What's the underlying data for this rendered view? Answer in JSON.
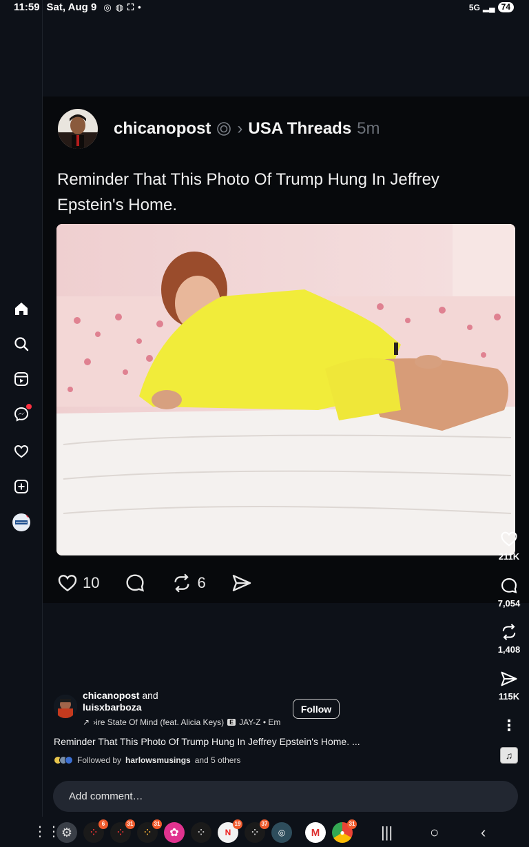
{
  "status_bar": {
    "time": "11:59",
    "date": "Sat, Aug 9",
    "network": "5G",
    "battery": "74"
  },
  "nav_rail": {
    "items": [
      {
        "icon": "home-icon"
      },
      {
        "icon": "search-icon"
      },
      {
        "icon": "reels-icon"
      },
      {
        "icon": "messenger-icon"
      },
      {
        "icon": "heart-icon"
      },
      {
        "icon": "create-icon"
      },
      {
        "icon": "profile-avatar"
      }
    ]
  },
  "post": {
    "username": "chicanopost",
    "community": "USA Threads",
    "time": "5m",
    "text": "Reminder That This Photo Of Trump Hung In Jeffrey Epstein's Home.",
    "likes": "10",
    "reposts": "6"
  },
  "right_actions": {
    "likes": "211K",
    "comments": "7,054",
    "reposts": "1,408",
    "shares": "115K"
  },
  "reel": {
    "user1": "chicanopost",
    "and": "and",
    "user2": "luisxbarboza",
    "follow_label": "Follow",
    "music": "›ire State Of Mind (feat. Alicia Keys)",
    "explicit": "E",
    "artist": "JAY-Z • Em",
    "caption": "Reminder That This Photo Of Trump Hung In Jeffrey Epstein's Home. ...",
    "followed_by_prefix": "Followed by",
    "followed_by_user": "harlowsmusings",
    "followed_by_suffix": "and 5 others"
  },
  "comment_placeholder": "Add comment…",
  "taskbar": {
    "badges": [
      "6",
      "31",
      "31",
      "19",
      "37",
      "31"
    ]
  },
  "colors": {
    "background": "#0d1118",
    "card": "#07090c",
    "notification": "#ff3040",
    "badge": "#f05a2c"
  }
}
